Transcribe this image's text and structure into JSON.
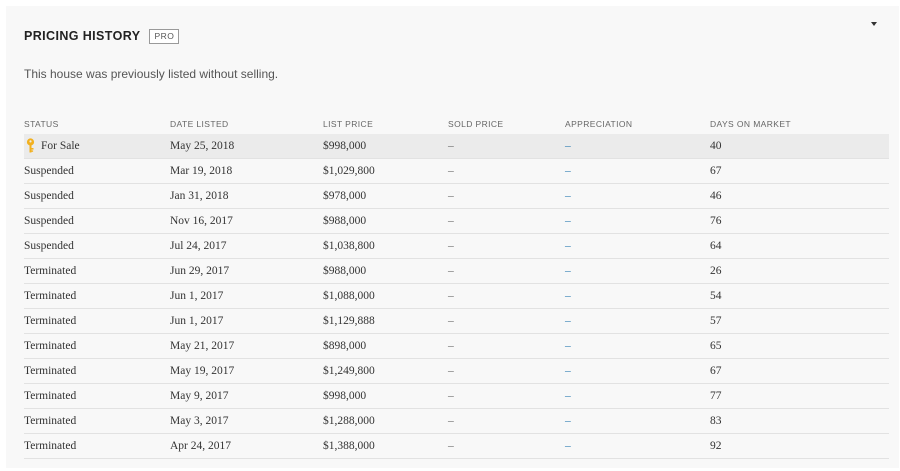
{
  "header": {
    "title": "PRICING HISTORY",
    "badge": "PRO"
  },
  "subtitle": "This house was previously listed without selling.",
  "columns": [
    "STATUS",
    "DATE LISTED",
    "LIST PRICE",
    "SOLD PRICE",
    "APPRECIATION",
    "DAYS ON MARKET"
  ],
  "rows": [
    {
      "status": "For Sale",
      "date": "May 25, 2018",
      "list": "$998,000",
      "sold": "–",
      "appreciation": "–",
      "days": "40",
      "icon": "key-icon"
    },
    {
      "status": "Suspended",
      "date": "Mar 19, 2018",
      "list": "$1,029,800",
      "sold": "–",
      "appreciation": "–",
      "days": "67"
    },
    {
      "status": "Suspended",
      "date": "Jan 31, 2018",
      "list": "$978,000",
      "sold": "–",
      "appreciation": "–",
      "days": "46"
    },
    {
      "status": "Suspended",
      "date": "Nov 16, 2017",
      "list": "$988,000",
      "sold": "–",
      "appreciation": "–",
      "days": "76"
    },
    {
      "status": "Suspended",
      "date": "Jul 24, 2017",
      "list": "$1,038,800",
      "sold": "–",
      "appreciation": "–",
      "days": "64"
    },
    {
      "status": "Terminated",
      "date": "Jun 29, 2017",
      "list": "$988,000",
      "sold": "–",
      "appreciation": "–",
      "days": "26"
    },
    {
      "status": "Terminated",
      "date": "Jun 1, 2017",
      "list": "$1,088,000",
      "sold": "–",
      "appreciation": "–",
      "days": "54"
    },
    {
      "status": "Terminated",
      "date": "Jun 1, 2017",
      "list": "$1,129,888",
      "sold": "–",
      "appreciation": "–",
      "days": "57"
    },
    {
      "status": "Terminated",
      "date": "May 21, 2017",
      "list": "$898,000",
      "sold": "–",
      "appreciation": "–",
      "days": "65"
    },
    {
      "status": "Terminated",
      "date": "May 19, 2017",
      "list": "$1,249,800",
      "sold": "–",
      "appreciation": "–",
      "days": "67"
    },
    {
      "status": "Terminated",
      "date": "May 9, 2017",
      "list": "$998,000",
      "sold": "–",
      "appreciation": "–",
      "days": "77"
    },
    {
      "status": "Terminated",
      "date": "May 3, 2017",
      "list": "$1,288,000",
      "sold": "–",
      "appreciation": "–",
      "days": "83"
    },
    {
      "status": "Terminated",
      "date": "Apr 24, 2017",
      "list": "$1,388,000",
      "sold": "–",
      "appreciation": "–",
      "days": "92"
    }
  ],
  "colors": {
    "appreciation_dash": "#2a7ab0",
    "key_icon": "#f2b01e",
    "highlight_row": "#ebebeb"
  }
}
